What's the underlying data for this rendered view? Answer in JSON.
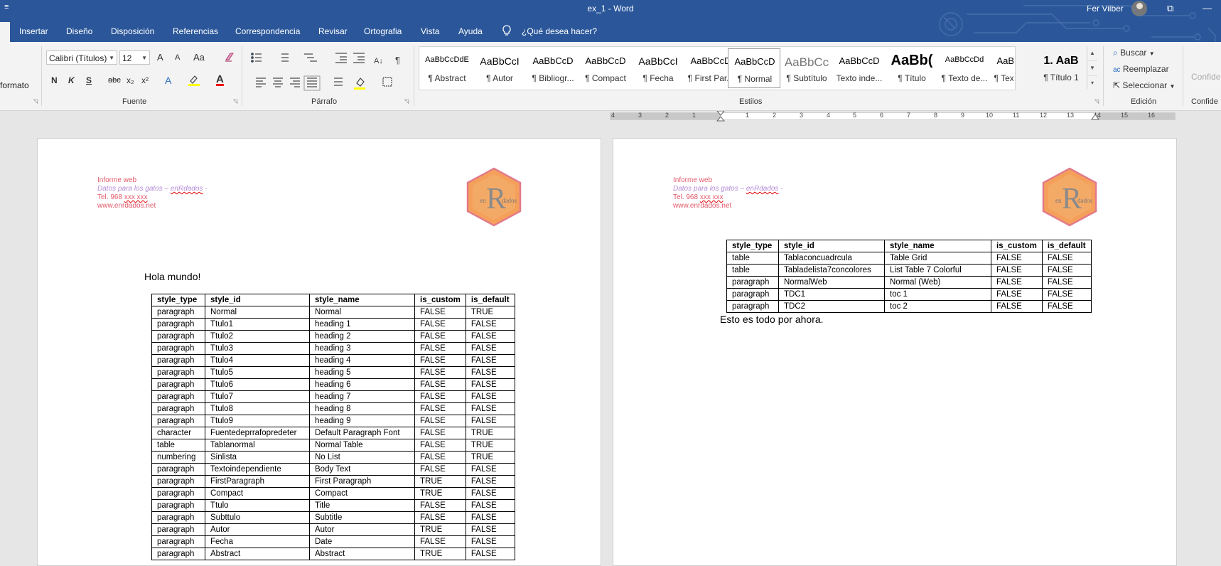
{
  "titlebar": {
    "quick_access": "≡",
    "title": "ex_1  -  Word",
    "user": "Fer Vilber",
    "restore_glyph": "⧉",
    "minimize_glyph": "—"
  },
  "tabs": [
    "Insertar",
    "Diseño",
    "Disposición",
    "Referencias",
    "Correspondencia",
    "Revisar",
    "Ortografia",
    "Vista",
    "Ayuda"
  ],
  "tell_me": "¿Qué desea hacer?",
  "ribbon": {
    "clipboard_fragment": "formato",
    "font": {
      "name": "Calibri (Títulos)",
      "size": "12",
      "grow": "A",
      "shrink": "A",
      "case": "Aa",
      "bold": "N",
      "italic": "K",
      "underline": "S",
      "strike": "abc",
      "sub": "x₂",
      "sup": "x²",
      "label": "Fuente"
    },
    "paragraph_label": "Párrafo",
    "styles_label": "Estilos",
    "styles": [
      {
        "preview": "AaBbCcDdE",
        "label": "¶ Abstract"
      },
      {
        "preview": "AaBbCcI",
        "label": "¶ Autor"
      },
      {
        "preview": "AaBbCcD",
        "label": "¶ Bibliogr..."
      },
      {
        "preview": "AaBbCcD",
        "label": "¶ Compact"
      },
      {
        "preview": "AaBbCcI",
        "label": "¶ Fecha"
      },
      {
        "preview": "AaBbCcD",
        "label": "¶ First Par..."
      },
      {
        "preview": "AaBbCcD",
        "label": "¶ Normal"
      },
      {
        "preview": "AaBbCc",
        "label": "¶ Subtítulo"
      },
      {
        "preview": "AaBbCcD",
        "label": "Texto inde..."
      },
      {
        "preview": "AaBb(",
        "label": "¶ Título"
      },
      {
        "preview": "AaBbCcDd",
        "label": "¶ Texto de..."
      },
      {
        "preview": "AaBbCcD",
        "label": "¶ Texto no..."
      },
      {
        "preview": "1.  AaB",
        "label": "¶ Título 1"
      }
    ],
    "editing": {
      "find": "Buscar",
      "replace": "Reemplazar",
      "select": "Seleccionar",
      "label": "Edición"
    },
    "sensitivity": {
      "button": "Confide",
      "label": "Confide"
    }
  },
  "ruler": {
    "left_numbers": [
      "4",
      "3",
      "2",
      "1"
    ],
    "right_numbers": [
      "1",
      "2",
      "3",
      "4",
      "5",
      "6",
      "7",
      "8",
      "9",
      "10",
      "11",
      "12",
      "13",
      "14",
      "15",
      "16"
    ]
  },
  "page1": {
    "header": {
      "line1": "Informe web",
      "line2a": "Datos para los gatos – ",
      "line2b": "enRdados",
      "line2c": " -",
      "line3a": "Tel. 968 ",
      "line3b": "xxx xxx",
      "line4": "www.enrdados.net"
    },
    "logo": {
      "left": "en",
      "big": "R",
      "right": "dados"
    },
    "hello": "Hola mundo!",
    "table": {
      "columns": [
        "style_type",
        "style_id",
        "style_name",
        "is_custom",
        "is_default"
      ],
      "rows": [
        [
          "paragraph",
          "Normal",
          "Normal",
          "FALSE",
          "TRUE"
        ],
        [
          "paragraph",
          "Ttulo1",
          "heading 1",
          "FALSE",
          "FALSE"
        ],
        [
          "paragraph",
          "Ttulo2",
          "heading 2",
          "FALSE",
          "FALSE"
        ],
        [
          "paragraph",
          "Ttulo3",
          "heading 3",
          "FALSE",
          "FALSE"
        ],
        [
          "paragraph",
          "Ttulo4",
          "heading 4",
          "FALSE",
          "FALSE"
        ],
        [
          "paragraph",
          "Ttulo5",
          "heading 5",
          "FALSE",
          "FALSE"
        ],
        [
          "paragraph",
          "Ttulo6",
          "heading 6",
          "FALSE",
          "FALSE"
        ],
        [
          "paragraph",
          "Ttulo7",
          "heading 7",
          "FALSE",
          "FALSE"
        ],
        [
          "paragraph",
          "Ttulo8",
          "heading 8",
          "FALSE",
          "FALSE"
        ],
        [
          "paragraph",
          "Ttulo9",
          "heading 9",
          "FALSE",
          "FALSE"
        ],
        [
          "character",
          "Fuentedeprrafopredeter",
          "Default Paragraph Font",
          "FALSE",
          "TRUE"
        ],
        [
          "table",
          "Tablanormal",
          "Normal Table",
          "FALSE",
          "TRUE"
        ],
        [
          "numbering",
          "Sinlista",
          "No List",
          "FALSE",
          "TRUE"
        ],
        [
          "paragraph",
          "Textoindependiente",
          "Body Text",
          "FALSE",
          "FALSE"
        ],
        [
          "paragraph",
          "FirstParagraph",
          "First Paragraph",
          "TRUE",
          "FALSE"
        ],
        [
          "paragraph",
          "Compact",
          "Compact",
          "TRUE",
          "FALSE"
        ],
        [
          "paragraph",
          "Ttulo",
          "Title",
          "FALSE",
          "FALSE"
        ],
        [
          "paragraph",
          "Subttulo",
          "Subtitle",
          "FALSE",
          "FALSE"
        ],
        [
          "paragraph",
          "Autor",
          "Autor",
          "TRUE",
          "FALSE"
        ],
        [
          "paragraph",
          "Fecha",
          "Date",
          "FALSE",
          "FALSE"
        ],
        [
          "paragraph",
          "Abstract",
          "Abstract",
          "TRUE",
          "FALSE"
        ]
      ]
    }
  },
  "page2": {
    "header": {
      "line1": "Informe web",
      "line2a": "Datos para los gatos – ",
      "line2b": "enRdados",
      "line2c": " -",
      "line3a": "Tel. 968 ",
      "line3b": "xxx xxx",
      "line4": "www.enrdados.net"
    },
    "logo": {
      "left": "en",
      "big": "R",
      "right": "dados"
    },
    "table": {
      "columns": [
        "style_type",
        "style_id",
        "style_name",
        "is_custom",
        "is_default"
      ],
      "rows": [
        [
          "table",
          "Tablaconcuadrcula",
          "Table Grid",
          "FALSE",
          "FALSE"
        ],
        [
          "table",
          "Tabladelista7concolores",
          "List Table 7 Colorful",
          "FALSE",
          "FALSE"
        ],
        [
          "paragraph",
          "NormalWeb",
          "Normal (Web)",
          "FALSE",
          "FALSE"
        ],
        [
          "paragraph",
          "TDC1",
          "toc 1",
          "FALSE",
          "FALSE"
        ],
        [
          "paragraph",
          "TDC2",
          "toc 2",
          "FALSE",
          "FALSE"
        ]
      ]
    },
    "closing": "Esto es todo por ahora."
  },
  "colors": {
    "word_blue": "#2b579a",
    "header_red": "#e25a6a",
    "header_purple": "#b48ad8",
    "logo_orange": "#f5a05a"
  }
}
